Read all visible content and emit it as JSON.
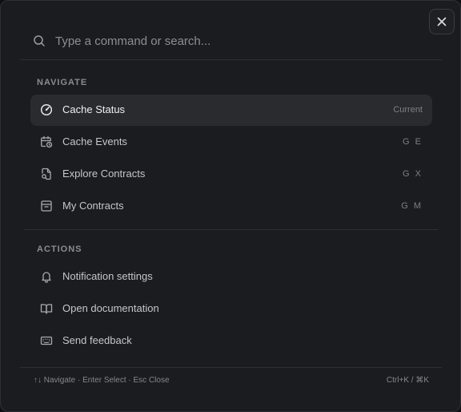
{
  "search": {
    "placeholder": "Type a command or search...",
    "value": ""
  },
  "sections": {
    "navigate": {
      "label": "NAVIGATE",
      "items": [
        {
          "label": "Cache Status",
          "hint": "Current",
          "icon": "gauge-icon",
          "active": true
        },
        {
          "label": "Cache Events",
          "hint": "G E",
          "icon": "calendar-clock-icon"
        },
        {
          "label": "Explore Contracts",
          "hint": "G X",
          "icon": "file-search-icon"
        },
        {
          "label": "My Contracts",
          "hint": "G M",
          "icon": "archive-icon"
        }
      ]
    },
    "actions": {
      "label": "ACTIONS",
      "items": [
        {
          "label": "Notification settings",
          "icon": "bell-icon"
        },
        {
          "label": "Open documentation",
          "icon": "book-open-icon"
        },
        {
          "label": "Send feedback",
          "icon": "keyboard-icon"
        }
      ]
    }
  },
  "footer": {
    "left": "↑↓ Navigate · Enter Select · Esc Close",
    "right": "Ctrl+K / ⌘K"
  },
  "colors": {
    "background": "#1b1c1f",
    "active_item": "#2a2b2f",
    "text": "#c4c6cb",
    "muted": "#8a8c92"
  }
}
